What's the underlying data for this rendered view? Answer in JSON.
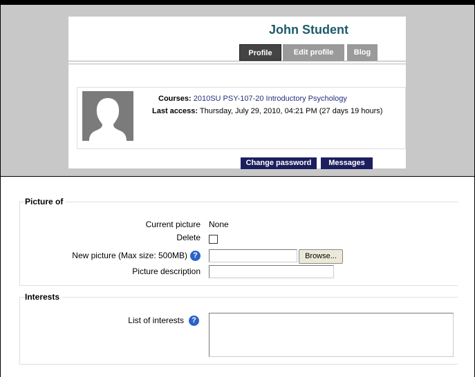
{
  "profile": {
    "name": "John Student",
    "tabs": [
      "Profile",
      "Edit profile",
      "Blog"
    ],
    "courses_label": "Courses:",
    "courses_value": "2010SU PSY-107-20 Introductory Psychology",
    "last_access_label": "Last access:",
    "last_access_value": "Thursday, July 29, 2010, 04:21 PM  (27 days 19 hours)",
    "buttons": [
      "Change password",
      "Messages"
    ]
  },
  "form": {
    "picture_section": {
      "legend": "Picture of",
      "current_picture_label": "Current picture",
      "current_picture_value": "None",
      "delete_label": "Delete",
      "new_picture_label": "New picture (Max size: 500MB)",
      "browse_label": "Browse...",
      "picture_description_label": "Picture description"
    },
    "interests_section": {
      "legend": "Interests",
      "list_label": "List of interests"
    }
  },
  "colors": {
    "name": "#1d5a6b",
    "dark_button": "#1c1f5e",
    "help_icon": "#2a62c9"
  }
}
